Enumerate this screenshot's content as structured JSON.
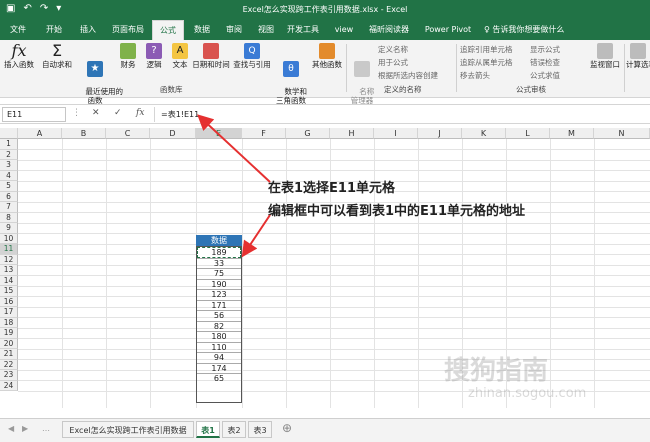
{
  "window": {
    "title": "Excel怎么实现跨工作表引用数据.xlsx - Excel"
  },
  "tabs": [
    "文件",
    "开始",
    "插入",
    "页面布局",
    "公式",
    "数据",
    "审阅",
    "视图",
    "开发工具",
    "view",
    "福昕阅读器",
    "Power Pivot"
  ],
  "tell_me": "告诉我你想要做什么",
  "ribbon": {
    "insert_function": "插入函数",
    "autosum": "自动求和",
    "recent": "最近使用的\n函数",
    "finance": "财务",
    "logic": "逻辑",
    "text": "文本",
    "datetime": "日期和时间",
    "lookup": "查找与引用",
    "math": "数学和\n三角函数",
    "other": "其他函数",
    "group_library": "函数库",
    "name_manager": "名称\n管理器",
    "define_name": "定义名称",
    "use_in_formula": "用于公式",
    "create_from_selection": "根据所选内容创建",
    "group_names": "定义的名称",
    "trace_precedents": "追踪引用单元格",
    "trace_dependents": "追踪从属单元格",
    "remove_arrows": "移去箭头",
    "show_formulas": "显示公式",
    "error_checking": "错误检查",
    "evaluate_formula": "公式求值",
    "group_audit": "公式审核",
    "watch_window": "监视窗口",
    "calc_options": "计算选项"
  },
  "formula_bar": {
    "name_box": "E11",
    "formula": "=表1!E11"
  },
  "columns": [
    "A",
    "B",
    "C",
    "D",
    "E",
    "F",
    "G",
    "H",
    "I",
    "J",
    "K",
    "L",
    "M",
    "N"
  ],
  "rows": [
    "1",
    "2",
    "3",
    "4",
    "5",
    "6",
    "7",
    "8",
    "9",
    "10",
    "11",
    "12",
    "13",
    "14",
    "15",
    "16",
    "17",
    "18",
    "19",
    "20",
    "21",
    "22",
    "23",
    "24"
  ],
  "table": {
    "header": "数据",
    "values": [
      "189",
      "33",
      "75",
      "190",
      "123",
      "171",
      "56",
      "82",
      "180",
      "110",
      "94",
      "174",
      "65"
    ]
  },
  "annotation": {
    "line1": "在表1选择E11单元格",
    "line2": "编辑框中可以看到表1中的E11单元格的地址"
  },
  "sheets": [
    "Excel怎么实现跨工作表引用数据",
    "表1",
    "表2",
    "表3"
  ],
  "watermark": {
    "line1": "搜狗指南",
    "line2": "zhinan.sogou.com"
  },
  "colors": {
    "accent": "#217346",
    "table_header": "#2e75b6",
    "arrow": "#e53030"
  }
}
